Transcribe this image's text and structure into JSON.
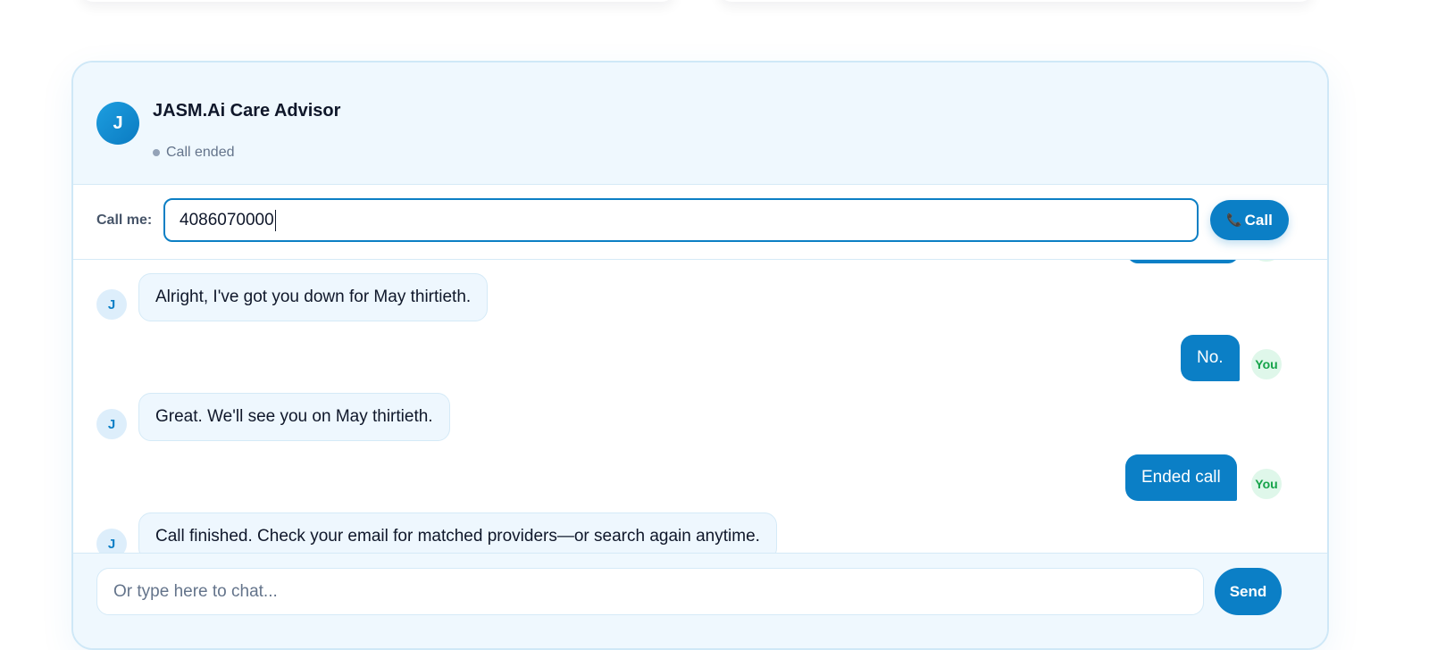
{
  "header": {
    "avatar_initial": "J",
    "title": "JASM.Ai Care Advisor",
    "status": "Call ended"
  },
  "call_row": {
    "label": "Call me:",
    "phone_value": "4086070000",
    "call_button_label": "Call",
    "call_button_icon": "phone-icon"
  },
  "messages": [
    {
      "sender": "ai",
      "avatar": "J",
      "text": "Alright, I've got you down for May thirtieth."
    },
    {
      "sender": "user",
      "avatar": "You",
      "text": "No."
    },
    {
      "sender": "ai",
      "avatar": "J",
      "text": "Great. We'll see you on May thirtieth."
    },
    {
      "sender": "user",
      "avatar": "You",
      "text": "Ended call"
    },
    {
      "sender": "ai",
      "avatar": "J",
      "text": "Call finished. Check your email for matched providers—or search again anytime."
    }
  ],
  "composer": {
    "placeholder": "Or type here to chat...",
    "send_label": "Send"
  },
  "colors": {
    "accent": "#0b7fc6",
    "header_bg": "#eff8fe",
    "you_badge_bg": "#dff7ea",
    "you_badge_text": "#16a34a",
    "status_dot": "#94a3b8"
  }
}
